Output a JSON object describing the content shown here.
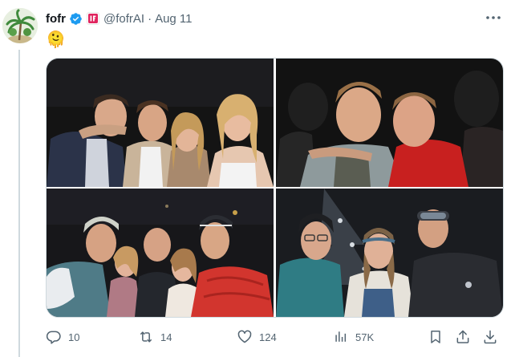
{
  "author": {
    "name": "fofr",
    "handle": "@fofrAI",
    "separator": "·",
    "date": "Aug 11"
  },
  "post": {
    "text": "🫠"
  },
  "media": {
    "count": 4,
    "descriptions": []
  },
  "actions": {
    "replies": "10",
    "reposts": "14",
    "likes": "124",
    "views": "57K"
  },
  "icons": [
    "verified-badge-icon",
    "affiliate-badge-icon",
    "more-icon",
    "reply-icon",
    "repost-icon",
    "like-icon",
    "views-icon",
    "bookmark-icon",
    "share-icon",
    "download-icon"
  ],
  "colors": {
    "verified": "#1d9bf0",
    "secondary_text": "#536471",
    "thread_line": "#cfd9de"
  }
}
